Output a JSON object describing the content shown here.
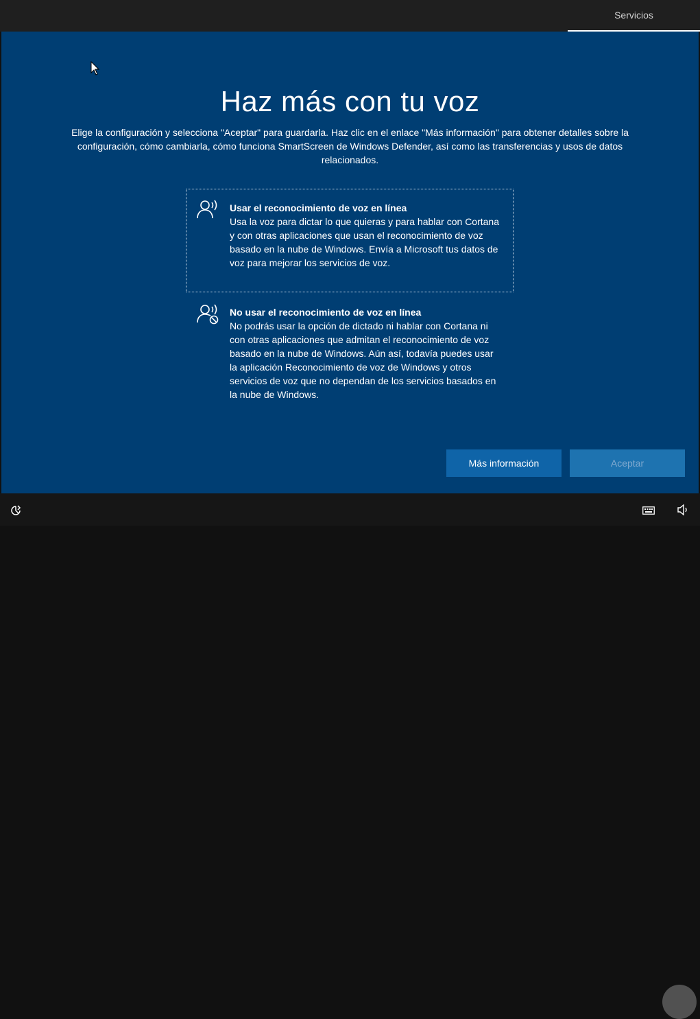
{
  "header": {
    "tab_label": "Servicios"
  },
  "main": {
    "title": "Haz más con tu voz",
    "description": "Elige la configuración y selecciona \"Aceptar\" para guardarla. Haz clic en el enlace \"Más información\" para obtener detalles sobre la configuración, cómo cambiarla, cómo funciona SmartScreen de Windows Defender, así como las transferencias y usos de datos relacionados.",
    "options": [
      {
        "icon": "speech-person-icon",
        "title": "Usar el reconocimiento de voz en línea",
        "body": "Usa la voz para dictar lo que quieras y para hablar con Cortana y con otras aplicaciones que usan el reconocimiento de voz basado en la nube de Windows. Envía a Microsoft tus datos de voz para mejorar los servicios de voz.",
        "selected": true
      },
      {
        "icon": "speech-person-blocked-icon",
        "title": "No usar el reconocimiento de voz en línea",
        "body": "No podrás usar la opción de dictado ni hablar con Cortana ni con otras aplicaciones que admitan el reconocimiento de voz basado en la nube de Windows. Aún así, todavía puedes usar la aplicación Reconocimiento de voz de Windows y otros servicios de voz que no dependan de los servicios basados en la nube de Windows.",
        "selected": false
      }
    ]
  },
  "buttons": {
    "more_info": "Más información",
    "accept": "Aceptar"
  },
  "bottom": {
    "icons": [
      "accessibility-icon",
      "keyboard-icon",
      "volume-icon"
    ]
  },
  "colors": {
    "background": "#003e73",
    "button_primary": "#0f64a8",
    "button_disabled": "#1e73b0",
    "topbar": "#1f1f1f",
    "bottombar": "#161616"
  }
}
